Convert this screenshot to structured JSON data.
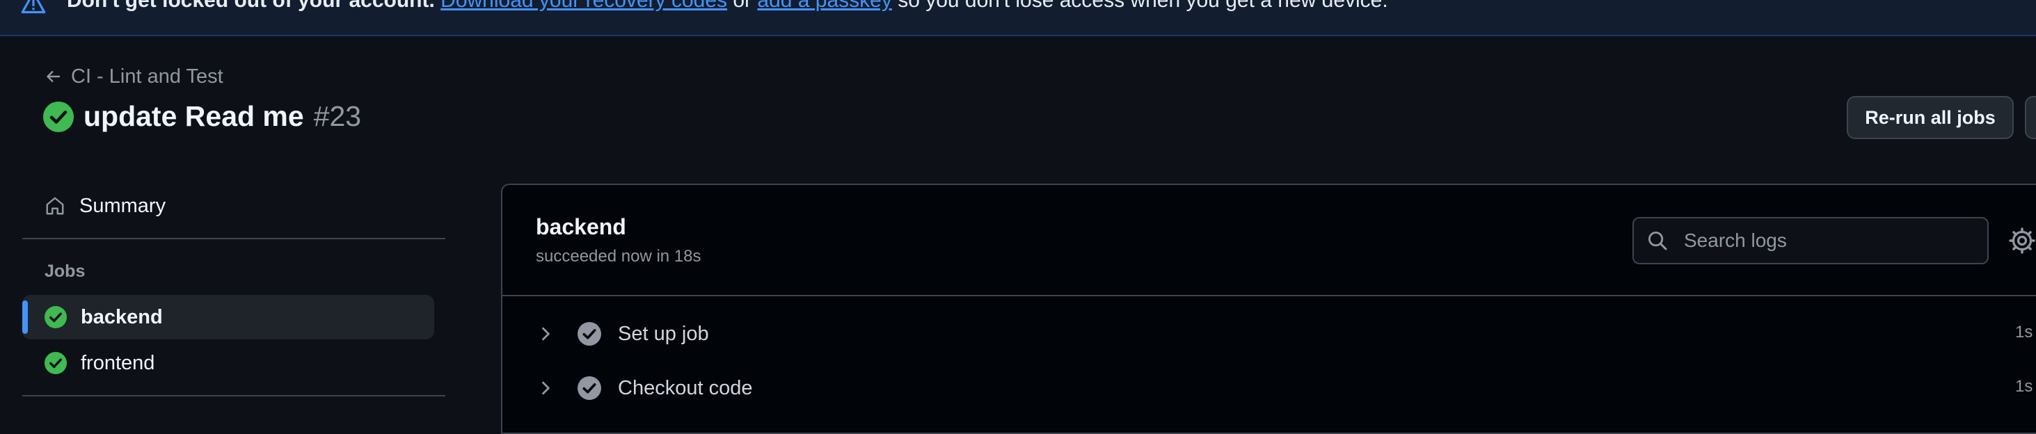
{
  "banner": {
    "lead": "Don't get locked out of your account.",
    "link1": "Download your recovery codes",
    "mid": " or ",
    "link2": "add a passkey",
    "tail": " so you don't lose access when you get a new device."
  },
  "header": {
    "back_label": "CI - Lint and Test",
    "title": "update Read me",
    "run_number": "#23",
    "rerun_label": "Re-run all jobs"
  },
  "sidebar": {
    "summary_label": "Summary",
    "jobs_heading": "Jobs",
    "jobs": [
      {
        "label": "backend",
        "status": "success",
        "active": true
      },
      {
        "label": "frontend",
        "status": "success",
        "active": false
      }
    ]
  },
  "job": {
    "title": "backend",
    "status_line": "succeeded now in 18s",
    "search_placeholder": "Search logs",
    "steps": [
      {
        "label": "Set up job",
        "duration": "1s"
      },
      {
        "label": "Checkout code",
        "duration": "1s"
      }
    ]
  },
  "colors": {
    "success": "#3fb950",
    "accent": "#4493f8",
    "step_check": "#9198a1"
  }
}
